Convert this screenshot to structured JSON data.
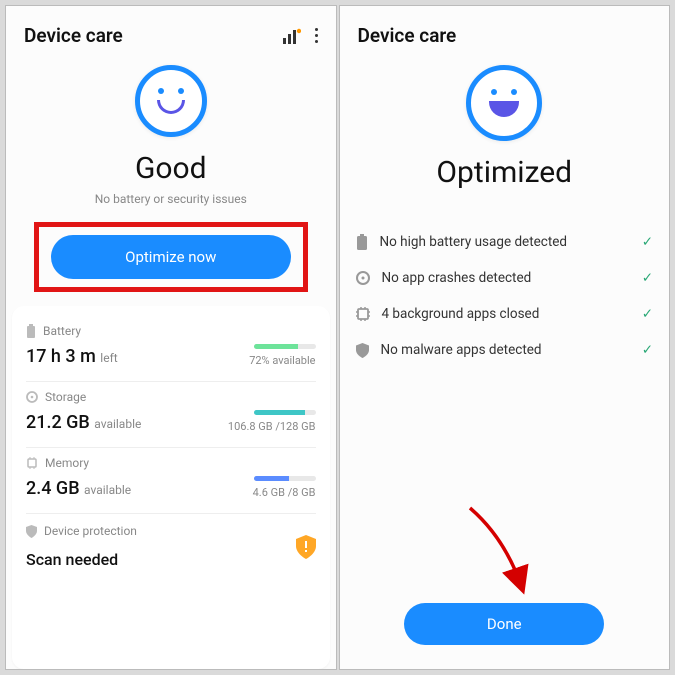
{
  "screen1": {
    "title": "Device care",
    "status": "Good",
    "subtitle": "No battery or security issues",
    "optimizeBtn": "Optimize now",
    "battery": {
      "label": "Battery",
      "valueMain": "17 h 3 m",
      "valueSuffix": "left",
      "rightText": "72% available",
      "barFill": 72,
      "barColor": "#6de39a"
    },
    "storage": {
      "label": "Storage",
      "valueMain": "21.2 GB",
      "valueSuffix": "available",
      "rightText": "106.8 GB /128 GB",
      "barFill": 83,
      "barColor": "#3ec6c6"
    },
    "memory": {
      "label": "Memory",
      "valueMain": "2.4 GB",
      "valueSuffix": "available",
      "rightText": "4.6 GB /8 GB",
      "barFill": 57,
      "barColor": "#5b8cff"
    },
    "protection": {
      "label": "Device protection",
      "status": "Scan needed"
    }
  },
  "screen2": {
    "title": "Device care",
    "status": "Optimized",
    "items": {
      "0": "No high battery usage detected",
      "1": "No app crashes detected",
      "2": "4 background apps closed",
      "3": "No malware apps detected"
    },
    "doneBtn": "Done"
  }
}
